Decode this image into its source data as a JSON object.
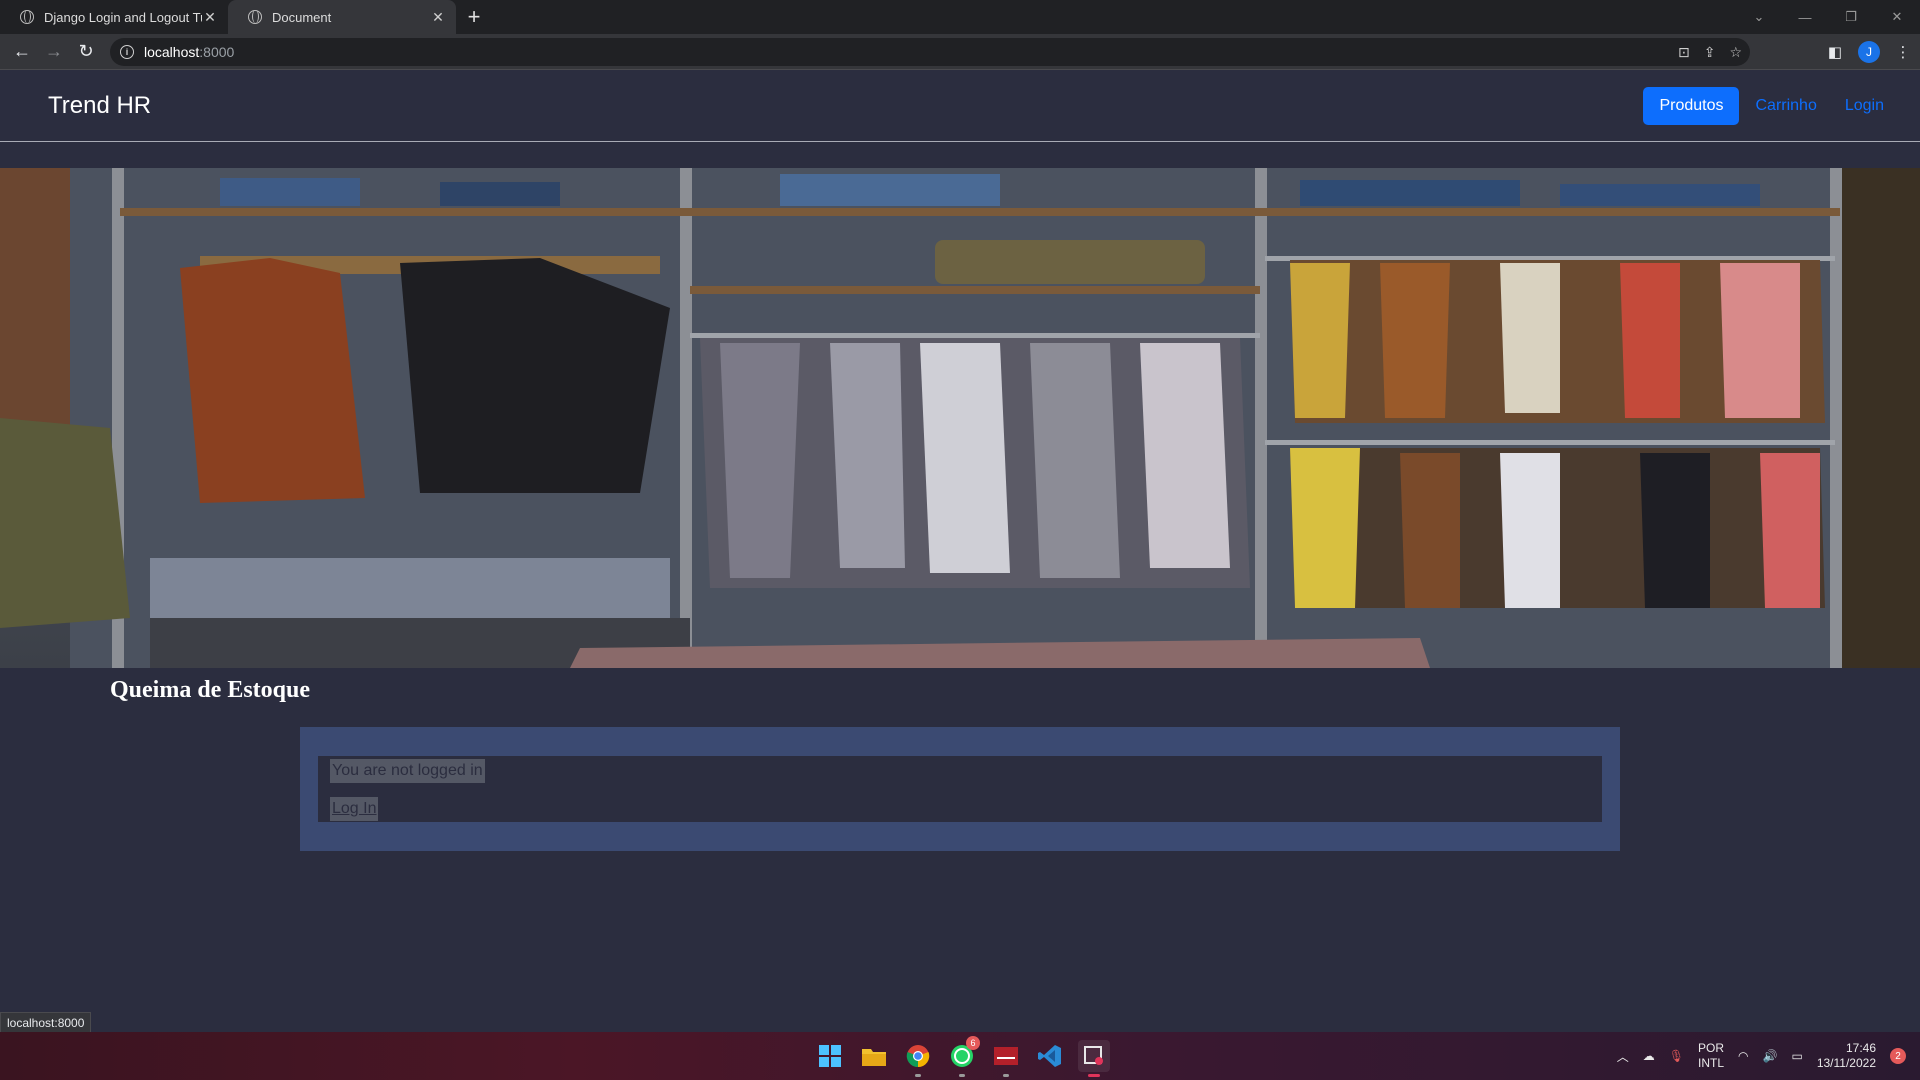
{
  "browser": {
    "tabs": [
      {
        "title": "Django Login and Logout Tutoria",
        "active": false
      },
      {
        "title": "Document",
        "active": true
      }
    ],
    "url_host": "localhost",
    "url_port": ":8000",
    "profile_initial": "J"
  },
  "site": {
    "brand": "Trend HR",
    "nav": {
      "produtos": "Produtos",
      "carrinho": "Carrinho",
      "login": "Login"
    },
    "section_title": "Queima de Estoque",
    "auth_card": {
      "message": "You are not logged in",
      "login_link": "Log In"
    }
  },
  "status_bar": "localhost:8000",
  "taskbar": {
    "whatsapp_badge": "6",
    "language_line1": "POR",
    "language_line2": "INTL",
    "time": "17:46",
    "date": "13/11/2022",
    "notifications": "2"
  },
  "colors": {
    "page_bg": "#2b2d3f",
    "primary": "#0d6efd",
    "card_outer": "#3b4a72"
  }
}
